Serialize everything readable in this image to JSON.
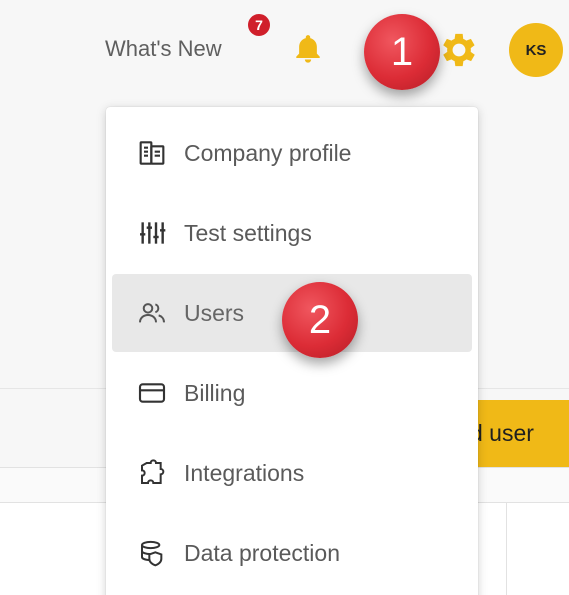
{
  "header": {
    "whats_new_label": "What's New",
    "whats_new_count": "7",
    "avatar_initials": "KS",
    "icons": [
      "bell-icon",
      "gear-icon"
    ],
    "accent_color": "#f0b917"
  },
  "annotations": {
    "step_1": "1",
    "step_2": "2",
    "marker_color": "#dc2c36"
  },
  "menu": {
    "items": [
      {
        "label": "Company profile",
        "icon": "building-icon"
      },
      {
        "label": "Test settings",
        "icon": "sliders-icon"
      },
      {
        "label": "Users",
        "icon": "users-icon",
        "active": true
      },
      {
        "label": "Billing",
        "icon": "credit-card-icon"
      },
      {
        "label": "Integrations",
        "icon": "puzzle-icon"
      },
      {
        "label": "Data protection",
        "icon": "shield-icon"
      }
    ]
  },
  "main": {
    "add_user_label": "d user"
  }
}
